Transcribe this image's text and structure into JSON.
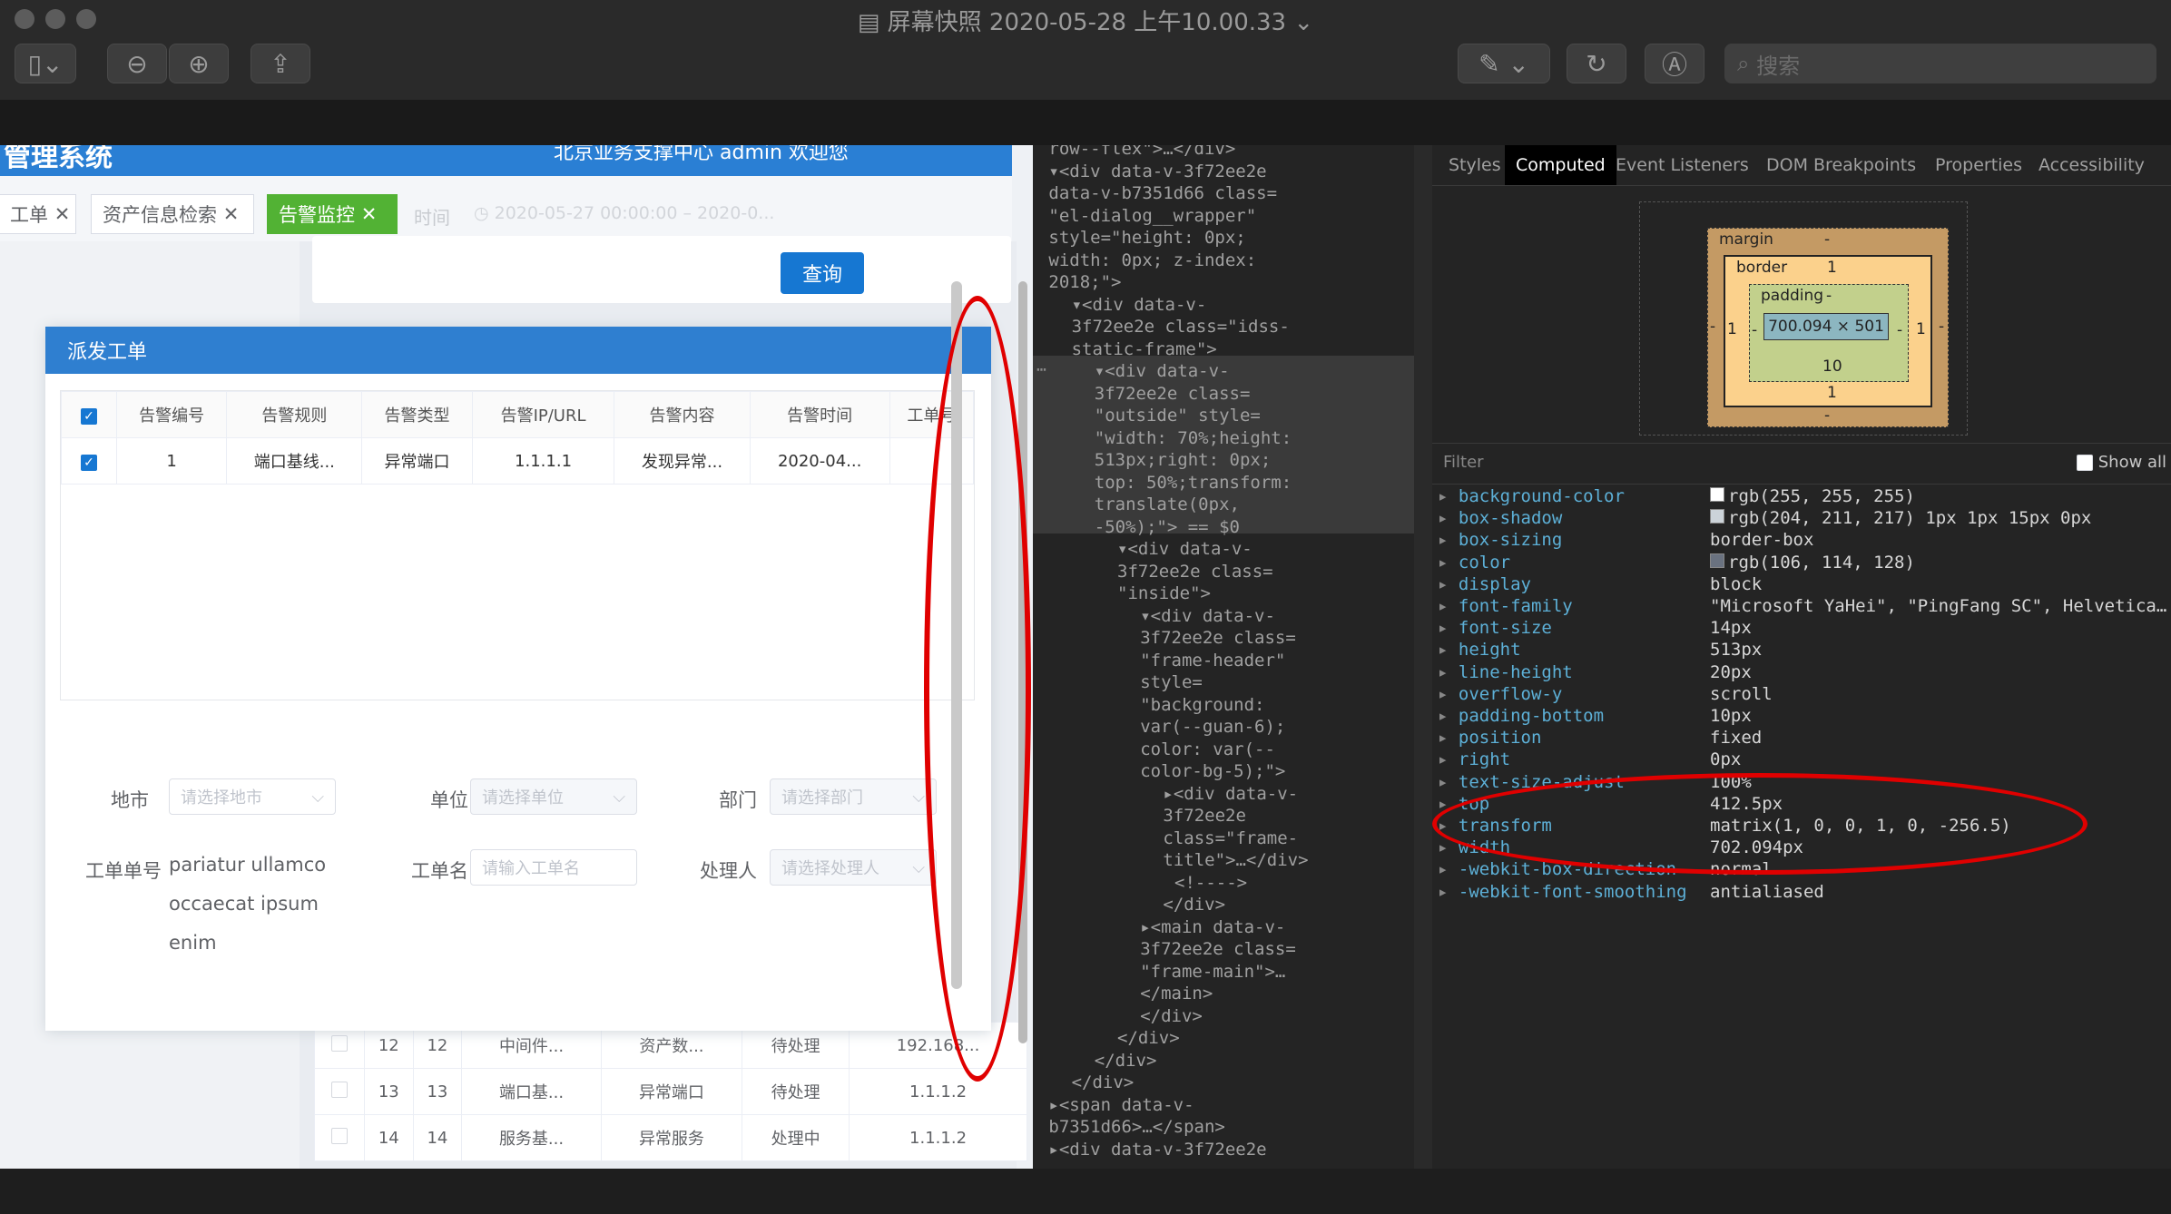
{
  "window": {
    "title": "屏幕快照 2020-05-28 上午10.00.33",
    "search_placeholder": "搜索"
  },
  "webapp": {
    "app_title": "管理系统",
    "user_info": "北京业务支撑中心  admin  欢迎您",
    "tabs": [
      {
        "label": "工单",
        "active": false
      },
      {
        "label": "资产信息检索",
        "active": false
      },
      {
        "label": "告警监控",
        "active": true
      }
    ],
    "time_label": "时间",
    "time_range": "2020-05-27 00:00:00  –  2020-0...",
    "query_button": "查询",
    "dialog": {
      "title": "派发工单",
      "columns": [
        "告警编号",
        "告警规则",
        "告警类型",
        "告警IP/URL",
        "告警内容",
        "告警时间",
        "工单号"
      ],
      "rows": [
        {
          "checked": true,
          "cells": [
            "1",
            "端口基线...",
            "异常端口",
            "1.1.1.1",
            "发现异常...",
            "2020-04...",
            ""
          ]
        }
      ],
      "form": {
        "city_label": "地市",
        "city_placeholder": "请选择地市",
        "unit_label": "单位",
        "unit_placeholder": "请选择单位",
        "dept_label": "部门",
        "dept_placeholder": "请选择部门",
        "order_no_label": "工单单号",
        "order_no_value": "pariatur ullamco occaecat ipsum enim",
        "order_name_label": "工单名",
        "order_name_placeholder": "请输入工单名",
        "handler_label": "处理人",
        "handler_placeholder": "请选择处理人"
      }
    },
    "background_table": [
      {
        "cells": [
          "12",
          "12",
          "中间件...",
          "资产数...",
          "待处理",
          "192.168..."
        ]
      },
      {
        "cells": [
          "13",
          "13",
          "端口基...",
          "异常端口",
          "待处理",
          "1.1.1.2"
        ]
      },
      {
        "cells": [
          "14",
          "14",
          "服务基...",
          "异常服务",
          "处理中",
          "1.1.1.2"
        ]
      }
    ]
  },
  "devtools": {
    "tabs": [
      {
        "label": "Styles",
        "active": false
      },
      {
        "label": "Computed",
        "active": true
      },
      {
        "label": "Event Listeners",
        "active": false
      },
      {
        "label": "DOM Breakpoints",
        "active": false
      },
      {
        "label": "Properties",
        "active": false
      },
      {
        "label": "Accessibility",
        "active": false
      }
    ],
    "box_model": {
      "margin_label": "margin",
      "margin_top": "-",
      "margin_bottom": "-",
      "margin_left": "-",
      "margin_right": "-",
      "border_label": "border",
      "border_top": "1",
      "border_bottom": "1",
      "border_left": "1",
      "border_right": "1",
      "padding_label": "padding",
      "padding_top": "-",
      "padding_bottom": "10",
      "padding_left": "-",
      "padding_right": "-",
      "content": "700.094 × 501"
    },
    "filter_placeholder": "Filter",
    "show_all_label": "Show all",
    "computed": [
      {
        "name": "background-color",
        "value": "rgb(255, 255, 255)",
        "swatch": "#ffffff"
      },
      {
        "name": "box-shadow",
        "value": "rgb(204, 211, 217) 1px 1px 15px 0px",
        "swatch": "#ccd3d9"
      },
      {
        "name": "box-sizing",
        "value": "border-box",
        "swatch": ""
      },
      {
        "name": "color",
        "value": "rgb(106, 114, 128)",
        "swatch": "#6a7280"
      },
      {
        "name": "display",
        "value": "block",
        "swatch": ""
      },
      {
        "name": "font-family",
        "value": "\"Microsoft YaHei\", \"PingFang SC\", Helvetica…",
        "swatch": ""
      },
      {
        "name": "font-size",
        "value": "14px",
        "swatch": ""
      },
      {
        "name": "height",
        "value": "513px",
        "swatch": ""
      },
      {
        "name": "line-height",
        "value": "20px",
        "swatch": ""
      },
      {
        "name": "overflow-y",
        "value": "scroll",
        "swatch": ""
      },
      {
        "name": "padding-bottom",
        "value": "10px",
        "swatch": ""
      },
      {
        "name": "position",
        "value": "fixed",
        "swatch": ""
      },
      {
        "name": "right",
        "value": "0px",
        "swatch": ""
      },
      {
        "name": "text-size-adjust",
        "value": "100%",
        "swatch": ""
      },
      {
        "name": "top",
        "value": "412.5px",
        "swatch": ""
      },
      {
        "name": "transform",
        "value": "matrix(1, 0, 0, 1, 0, -256.5)",
        "swatch": ""
      },
      {
        "name": "width",
        "value": "702.094px",
        "swatch": ""
      },
      {
        "name": "-webkit-box-direction",
        "value": "normal",
        "swatch": ""
      },
      {
        "name": "-webkit-font-smoothing",
        "value": "antialiased",
        "swatch": ""
      }
    ],
    "elements_lines": [
      {
        "indent": 9,
        "text": "row--flex\">…</div>"
      },
      {
        "indent": 9,
        "text": "▾<div data-v-3f72ee2e"
      },
      {
        "indent": 9,
        "text": "data-v-b7351d66 class="
      },
      {
        "indent": 9,
        "text": "\"el-dialog__wrapper\""
      },
      {
        "indent": 9,
        "text": "style=\"height: 0px;"
      },
      {
        "indent": 9,
        "text": "width: 0px; z-index:"
      },
      {
        "indent": 9,
        "text": "2018;\">"
      },
      {
        "indent": 11,
        "text": "▾<div data-v-"
      },
      {
        "indent": 11,
        "text": "3f72ee2e class=\"idss-"
      },
      {
        "indent": 11,
        "text": "static-frame\">"
      },
      {
        "indent": 13,
        "text": "▾<div data-v-"
      },
      {
        "indent": 13,
        "text": "3f72ee2e class="
      },
      {
        "indent": 13,
        "text": "\"outside\" style="
      },
      {
        "indent": 13,
        "text": "\"width: 70%;height:"
      },
      {
        "indent": 13,
        "text": "513px;right: 0px;"
      },
      {
        "indent": 13,
        "text": "top: 50%;transform:"
      },
      {
        "indent": 13,
        "text": "translate(0px,"
      },
      {
        "indent": 13,
        "text": "-50%);\"> == $0"
      },
      {
        "indent": 15,
        "text": "▾<div data-v-"
      },
      {
        "indent": 15,
        "text": "3f72ee2e class="
      },
      {
        "indent": 15,
        "text": "\"inside\">"
      },
      {
        "indent": 17,
        "text": "▾<div data-v-"
      },
      {
        "indent": 17,
        "text": "3f72ee2e class="
      },
      {
        "indent": 17,
        "text": "\"frame-header\""
      },
      {
        "indent": 17,
        "text": "style="
      },
      {
        "indent": 17,
        "text": "\"background:"
      },
      {
        "indent": 17,
        "text": "var(--guan-6);"
      },
      {
        "indent": 17,
        "text": "color: var(--"
      },
      {
        "indent": 17,
        "text": "color-bg-5);\">"
      },
      {
        "indent": 19,
        "text": "▸<div data-v-"
      },
      {
        "indent": 19,
        "text": "3f72ee2e"
      },
      {
        "indent": 19,
        "text": "class=\"frame-"
      },
      {
        "indent": 19,
        "text": "title\">…</div>"
      },
      {
        "indent": 20,
        "text": "<!---->"
      },
      {
        "indent": 19,
        "text": "</div>"
      },
      {
        "indent": 17,
        "text": "▸<main data-v-"
      },
      {
        "indent": 17,
        "text": "3f72ee2e class="
      },
      {
        "indent": 17,
        "text": "\"frame-main\">…"
      },
      {
        "indent": 17,
        "text": "</main>"
      },
      {
        "indent": 17,
        "text": "</div>"
      },
      {
        "indent": 15,
        "text": "</div>"
      },
      {
        "indent": 13,
        "text": "</div>"
      },
      {
        "indent": 11,
        "text": "</div>"
      },
      {
        "indent": 9,
        "text": "▸<span data-v-"
      },
      {
        "indent": 9,
        "text": "b7351d66>…</span>"
      },
      {
        "indent": 9,
        "text": "▸<div data-v-3f72ee2e"
      }
    ]
  },
  "annotation_color": "#e00000"
}
